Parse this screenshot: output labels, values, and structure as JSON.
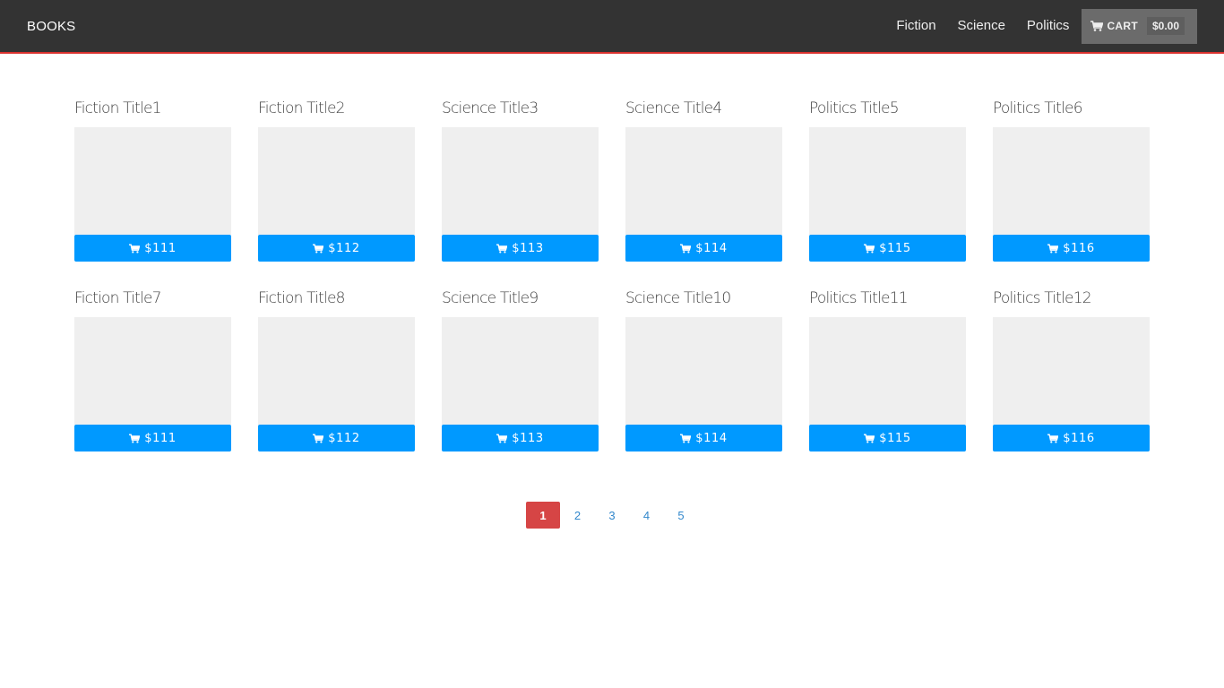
{
  "navbar": {
    "brand": "BOOKS",
    "links": [
      "Fiction",
      "Science",
      "Politics"
    ],
    "cart_label": "CART",
    "cart_total": "$0.00",
    "cart_icon": "cart-icon"
  },
  "products": [
    {
      "title": "Fiction Title1",
      "price": "$111"
    },
    {
      "title": "Fiction Title2",
      "price": "$112"
    },
    {
      "title": "Science Title3",
      "price": "$113"
    },
    {
      "title": "Science Title4",
      "price": "$114"
    },
    {
      "title": "Politics Title5",
      "price": "$115"
    },
    {
      "title": "Politics Title6",
      "price": "$116"
    },
    {
      "title": "Fiction Title7",
      "price": "$111"
    },
    {
      "title": "Fiction Title8",
      "price": "$112"
    },
    {
      "title": "Science Title9",
      "price": "$113"
    },
    {
      "title": "Science Title10",
      "price": "$114"
    },
    {
      "title": "Politics Title11",
      "price": "$115"
    },
    {
      "title": "Politics Title12",
      "price": "$116"
    }
  ],
  "pagination": {
    "pages": [
      "1",
      "2",
      "3",
      "4",
      "5"
    ],
    "current": "1"
  },
  "colors": {
    "navbar_bg": "#333333",
    "navbar_accent": "#d9312e",
    "buy_button": "#0099ff",
    "active_page": "#d64545",
    "page_link": "#3388cc"
  }
}
